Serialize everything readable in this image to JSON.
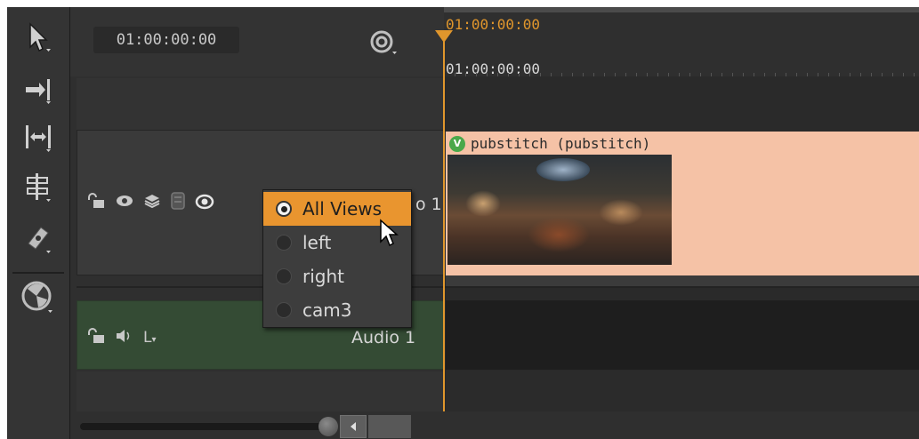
{
  "header": {
    "timecode": "01:00:00:00"
  },
  "ruler": {
    "playhead_timecode": "01:00:00:00",
    "start_timecode": "01:00:00:00"
  },
  "tracks": {
    "video": {
      "label": "o 1"
    },
    "audio": {
      "label": "Audio 1",
      "channel": "L"
    }
  },
  "clip": {
    "badge": "V",
    "title": "pubstitch (pubstitch)"
  },
  "views_menu": {
    "items": [
      {
        "label": "All Views",
        "selected": true
      },
      {
        "label": "left",
        "selected": false
      },
      {
        "label": "right",
        "selected": false
      },
      {
        "label": "cam3",
        "selected": false
      }
    ]
  },
  "colors": {
    "accent": "#e9952f",
    "clip": "#f5c2a6",
    "audio_track": "#344b34",
    "background": "#2f2f2f"
  },
  "icons": {
    "toolbar": [
      "select-arrow-icon",
      "track-insert-icon",
      "range-icon",
      "slip-icon",
      "razor-icon",
      "nuke-logo-icon"
    ],
    "video_track": [
      "lock-icon",
      "eye-icon",
      "layers-icon",
      "disk-icon",
      "stereo-eye-icon"
    ],
    "audio_track": [
      "lock-icon",
      "speaker-icon"
    ]
  }
}
